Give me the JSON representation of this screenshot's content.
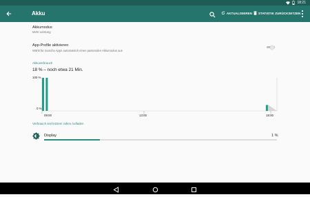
{
  "status_bar": {
    "time": "18:21"
  },
  "toolbar": {
    "title": "Akku",
    "refresh_label": "AKTUALISIEREN",
    "reset_label": "STATISTIK ZURÜCKSETZEN"
  },
  "settings": {
    "battery_mode": {
      "title": "Akkumodus",
      "summary": "Mehr Leistung"
    },
    "app_profiles": {
      "title": "App-Profile aktivieren",
      "summary": "Wählt für manche Apps automatisch einen passenden Akkumodus aus",
      "enabled": false
    }
  },
  "battery_usage": {
    "header": "Akkuverbrauch",
    "status": "18 % – noch etwa 21 Min."
  },
  "chart_data": {
    "type": "area",
    "y_tick_labels": [
      "100 %",
      "0 %"
    ],
    "x_tick_labels": [
      "09:00",
      "13:00",
      "18:00"
    ],
    "ylim": [
      0,
      100
    ],
    "series_color": "#1f9e8a",
    "bars": [
      {
        "position_hours": 8.85,
        "level": 100
      },
      {
        "position_hours": 9.0,
        "level": 100
      },
      {
        "position_hours": 17.95,
        "level": 18
      }
    ]
  },
  "usage_section": {
    "header": "Verbrauch seit letztem vollen Aufladen",
    "items": [
      {
        "label": "Display",
        "percent_label": "1 %",
        "fraction": 0.24
      }
    ]
  },
  "colors": {
    "accent": "#2e8b7f",
    "toolbar": "#26756c",
    "statusbar": "#1f5c56"
  }
}
